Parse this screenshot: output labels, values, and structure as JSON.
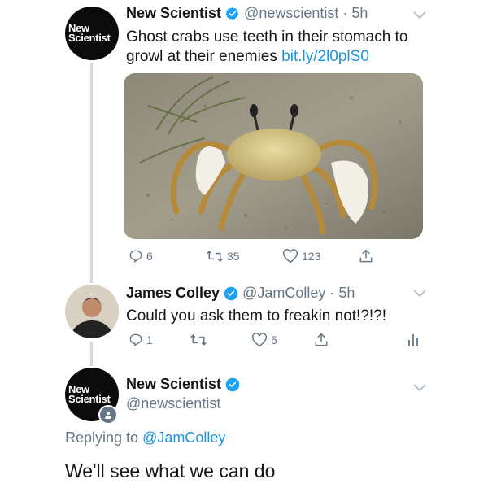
{
  "tweet1": {
    "avatar_text": [
      "New",
      "Scientist"
    ],
    "name": "New Scientist",
    "handle": "@newscientist",
    "time": "· 5h",
    "text_line1": "Ghost crabs use teeth in their stomach to",
    "text_line2": "growl at their enemies ",
    "link": "bit.ly/2l0plS0",
    "replies": "6",
    "retweets": "35",
    "likes": "123"
  },
  "tweet2": {
    "name": "James Colley",
    "handle": "@JamColley",
    "time": "· 5h",
    "text": "Could you ask them to freakin not!?!?!",
    "replies": "1",
    "retweets": "",
    "likes": "5"
  },
  "tweet3": {
    "avatar_text": [
      "New",
      "Scientist"
    ],
    "name": "New Scientist",
    "handle": "@newscientist",
    "replying_prefix": "Replying to ",
    "replying_to": "@JamColley",
    "text": "We'll see what we can do"
  },
  "colors": {
    "link": "#1b95e0",
    "muted": "#657786",
    "verified": "#1da1f2"
  },
  "icons": [
    "verified-badge-icon",
    "chevron-down-icon",
    "reply-icon",
    "retweet-icon",
    "like-icon",
    "share-icon",
    "analytics-icon",
    "follow-badge-icon"
  ]
}
